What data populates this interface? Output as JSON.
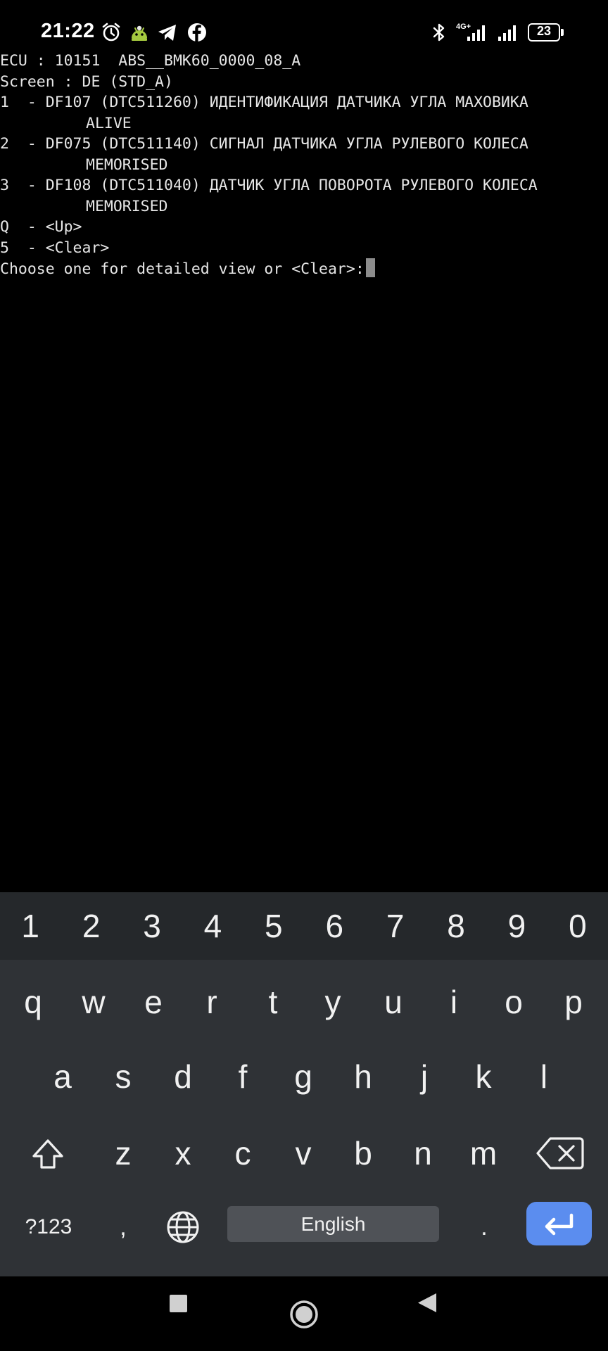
{
  "status_bar": {
    "time": "21:22",
    "network_type": "4G+",
    "battery_level": "23",
    "icons": [
      "alarm-icon",
      "android-app-icon",
      "telegram-icon",
      "facebook-icon",
      "bluetooth-icon",
      "signal-icon",
      "signal-icon-2",
      "battery-icon"
    ]
  },
  "terminal": {
    "lines": [
      "ECU : 10151  ABS__BMK60_0000_08_A",
      "Screen : DE (STD_A)",
      "1  - DF107 (DTC511260) ИДЕНТИФИКАЦИЯ ДАТЧИКА УГЛА МАХОВИКА",
      "ALIVE",
      "2  - DF075 (DTC511140) СИГНАЛ ДАТЧИКА УГЛА РУЛЕВОГО КОЛЕСА",
      "MEMORISED",
      "3  - DF108 (DTC511040) ДАТЧИК УГЛА ПОВОРОТА РУЛЕВОГО КОЛЕСА",
      "MEMORISED",
      "Q  - <Up>",
      "5  - <Clear>",
      "Choose one for detailed view or <Clear>:"
    ],
    "input_value": ""
  },
  "keyboard": {
    "number_row": [
      "1",
      "2",
      "3",
      "4",
      "5",
      "6",
      "7",
      "8",
      "9",
      "0"
    ],
    "row1": [
      "q",
      "w",
      "e",
      "r",
      "t",
      "y",
      "u",
      "i",
      "o",
      "p"
    ],
    "row2": [
      "a",
      "s",
      "d",
      "f",
      "g",
      "h",
      "j",
      "k",
      "l"
    ],
    "row3": [
      "z",
      "x",
      "c",
      "v",
      "b",
      "n",
      "m"
    ],
    "symbols_label": "?123",
    "comma_label": ",",
    "space_label": "English",
    "period_label": ".",
    "accent_color": "#5b8def"
  },
  "nav_bar": {
    "buttons": [
      "recents-button",
      "home-button",
      "back-button"
    ]
  }
}
